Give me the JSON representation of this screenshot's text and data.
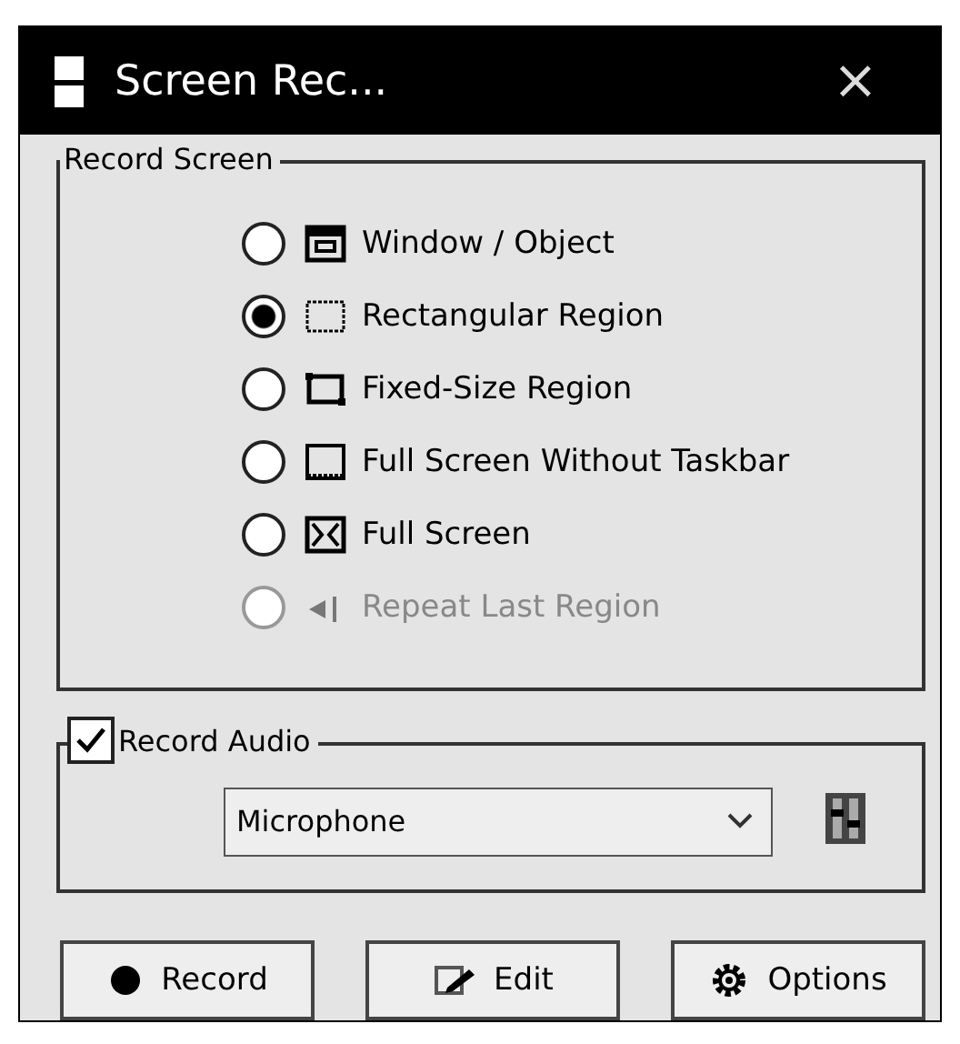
{
  "window": {
    "title": "Screen Rec...",
    "close": "×"
  },
  "record_screen": {
    "title": "Record Screen",
    "options": [
      {
        "label": "Window / Object",
        "selected": false,
        "disabled": false
      },
      {
        "label": "Rectangular Region",
        "selected": true,
        "disabled": false
      },
      {
        "label": "Fixed-Size Region",
        "selected": false,
        "disabled": false
      },
      {
        "label": "Full Screen Without Taskbar",
        "selected": false,
        "disabled": false
      },
      {
        "label": "Full Screen",
        "selected": false,
        "disabled": false
      },
      {
        "label": "Repeat Last Region",
        "selected": false,
        "disabled": true
      }
    ]
  },
  "record_audio": {
    "label": "Record Audio",
    "checked": true,
    "device": "Microphone"
  },
  "buttons": [
    {
      "label": "Record",
      "kind": "record"
    },
    {
      "label": "Edit",
      "kind": "edit"
    },
    {
      "label": "Options",
      "kind": "options"
    }
  ]
}
